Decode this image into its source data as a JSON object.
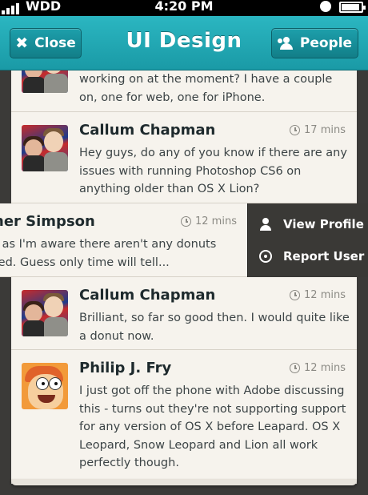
{
  "status_bar": {
    "carrier": "WDD",
    "time": "4:20 PM"
  },
  "nav": {
    "title": "UI Design",
    "close_label": "Close",
    "people_label": "People"
  },
  "messages": [
    {
      "name": "",
      "time": "",
      "text": "working on at the moment? I have a couple on, one for web, one for iPhone.",
      "avatar": "callum-avatar"
    },
    {
      "name": "Callum Chapman",
      "time": "17 mins",
      "text": "Hey guys, do any of you know if there are any issues with running Photoshop CS6 on anything older than OS X Lion?",
      "avatar": "callum-avatar"
    },
    {
      "name": "Callum Chapman",
      "time": "12 mins",
      "text": "Brilliant, so far so good then. I would quite like a donut now.",
      "avatar": "callum-avatar"
    },
    {
      "name": "Philip J. Fry",
      "time": "12 mins",
      "text": "I just got off the phone with Adobe discussing this - turns out they're not supporting support for any version of OS X before Leapard. OS X Leopard, Snow Leopard and Lion all work perfectly though.",
      "avatar": "fry-avatar"
    }
  ],
  "swiped_message": {
    "name": "ner Simpson",
    "time": "12 mins",
    "line1": "r as I'm aware there aren't any donuts",
    "line2": "ted. Guess only time will tell..."
  },
  "actions": {
    "view_profile": "View Profile",
    "report_user": "Report User"
  },
  "colors": {
    "accent": "#1fa9b5",
    "card": "#f6f3ed",
    "action_bg": "#3a3936"
  }
}
